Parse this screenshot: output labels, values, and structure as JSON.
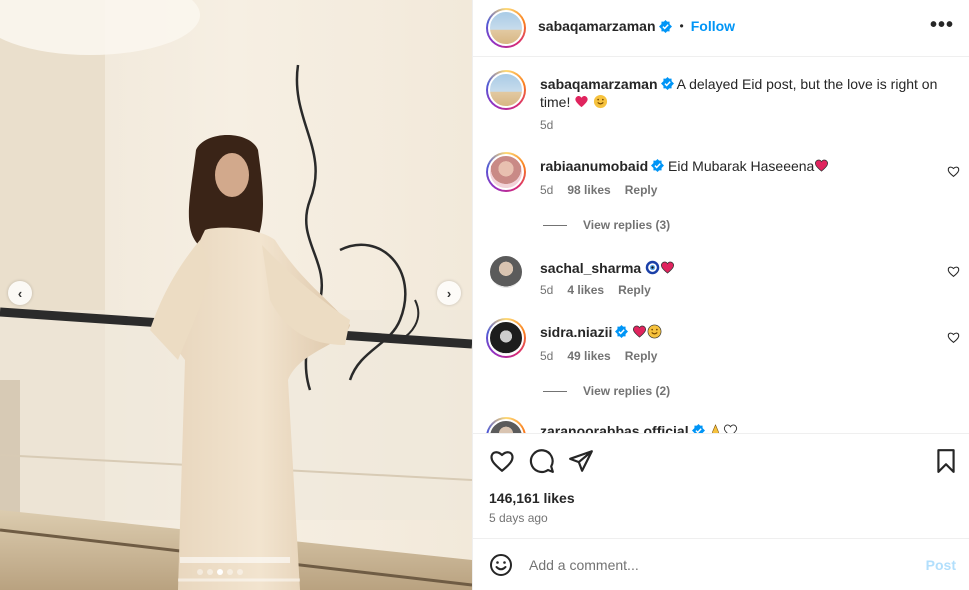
{
  "post": {
    "author": "sabaqamarzaman",
    "follow_label": "Follow",
    "more_label": "•••",
    "header_separator": "•"
  },
  "media": {
    "prev_label": "‹",
    "next_label": "›",
    "slide_count": 5,
    "active_slide": 3
  },
  "caption": {
    "username": "sabaqamarzaman",
    "text": "A delayed Eid post, but the love is right on time!",
    "time": "5d"
  },
  "comments": [
    {
      "username": "rabiaanumobaid",
      "verified": true,
      "text": "Eid Mubarak Haseeena",
      "time": "5d",
      "likes": "98 likes",
      "reply": "Reply",
      "view_replies": "View replies (3)"
    },
    {
      "username": "sachal_sharma",
      "verified": false,
      "text": "",
      "time": "5d",
      "likes": "4 likes",
      "reply": "Reply"
    },
    {
      "username": "sidra.niazii",
      "verified": true,
      "text": "",
      "time": "5d",
      "likes": "49 likes",
      "reply": "Reply",
      "view_replies": "View replies (2)"
    },
    {
      "username": "zaranoorabbas.official",
      "verified": true,
      "text": ""
    }
  ],
  "footer": {
    "likes": "146,161 likes",
    "date": "5 days ago",
    "comment_placeholder": "Add a comment...",
    "post_label": "Post"
  },
  "colors": {
    "accent": "#0095f6",
    "heart_red": "#e0245e",
    "muted_text": "#737373",
    "post_disabled": "#b2dffc"
  },
  "icons": {
    "like": "heart-icon",
    "comment": "comment-bubble-icon",
    "share": "paper-plane-icon",
    "save": "bookmark-icon",
    "emoji": "smiley-icon",
    "verified": "verified-badge-icon"
  }
}
